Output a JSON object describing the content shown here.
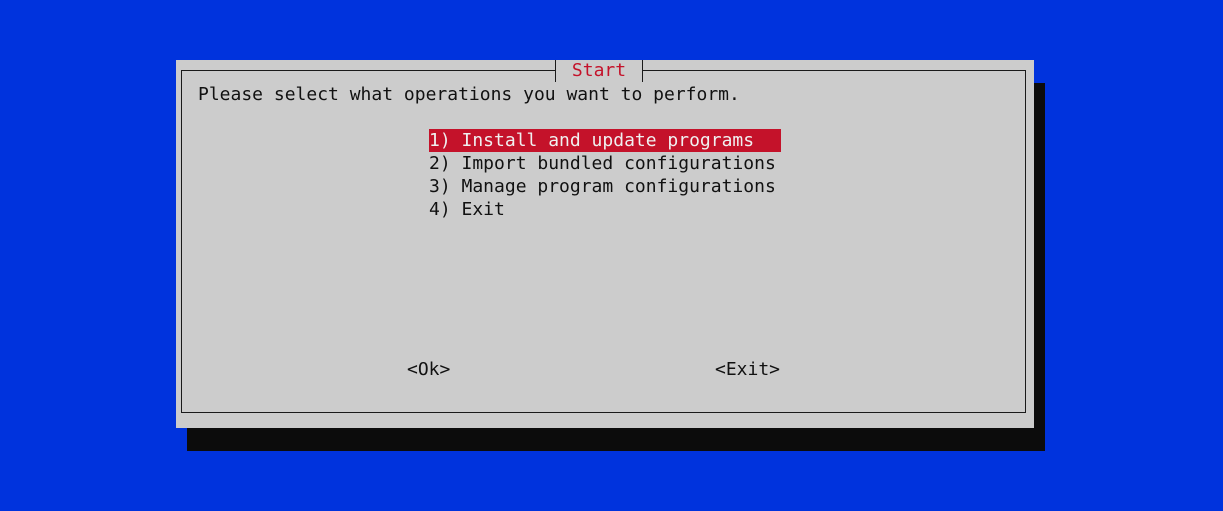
{
  "dialog": {
    "title": "Start",
    "prompt": "Please select what operations you want to perform."
  },
  "menu": {
    "selected_index": 0,
    "items": [
      {
        "label": "1) Install and update programs"
      },
      {
        "label": "2) Import bundled configurations"
      },
      {
        "label": "3) Manage program configurations"
      },
      {
        "label": "4) Exit"
      }
    ]
  },
  "buttons": {
    "ok_label": "<Ok>",
    "exit_label": "<Exit>"
  },
  "colors": {
    "background": "#0033dd",
    "dialog": "#cccccc",
    "accent": "#c4122a",
    "shadow": "#0c0c0c"
  }
}
